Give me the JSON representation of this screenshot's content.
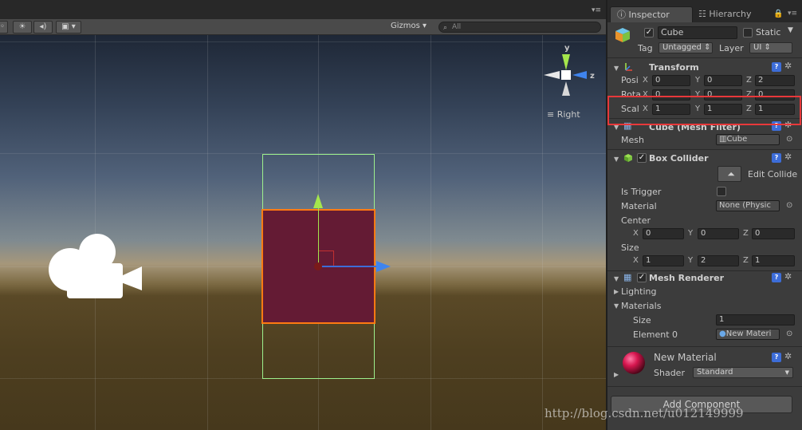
{
  "scene": {
    "gizmos_label": "Gizmos",
    "search_placeholder": "All",
    "orientation_label": "Right",
    "axis_y": "y",
    "axis_z": "z"
  },
  "tabs": {
    "inspector": "Inspector",
    "hierarchy": "Hierarchy"
  },
  "object": {
    "name": "Cube",
    "static_label": "Static",
    "tag_label": "Tag",
    "tag_value": "Untagged",
    "layer_label": "Layer",
    "layer_value": "UI"
  },
  "transform": {
    "title": "Transform",
    "position_label": "Posi",
    "rotation_label": "Rota",
    "scale_label": "Scal",
    "position": {
      "x": "0",
      "y": "0",
      "z": "2"
    },
    "rotation": {
      "x": "0",
      "y": "0",
      "z": "0"
    },
    "scale": {
      "x": "1",
      "y": "1",
      "z": "1"
    }
  },
  "mesh_filter": {
    "title": "Cube (Mesh Filter)",
    "mesh_label": "Mesh",
    "mesh_value": "Cube"
  },
  "box_collider": {
    "title": "Box Collider",
    "edit_label": "Edit Collide",
    "is_trigger_label": "Is Trigger",
    "material_label": "Material",
    "material_value": "None (Physic",
    "center_label": "Center",
    "center": {
      "x": "0",
      "y": "0",
      "z": "0"
    },
    "size_label": "Size",
    "size": {
      "x": "1",
      "y": "2",
      "z": "1"
    }
  },
  "mesh_renderer": {
    "title": "Mesh Renderer",
    "lighting_label": "Lighting",
    "materials_label": "Materials",
    "size_label": "Size",
    "size_value": "1",
    "element_label": "Element 0",
    "element_value": "New Materi"
  },
  "material": {
    "name": "New Material",
    "shader_label": "Shader",
    "shader_value": "Standard"
  },
  "add_component_label": "Add Component",
  "watermark": "http://blog.csdn.net/u012149999",
  "axis_letters": {
    "x": "X",
    "y": "Y",
    "z": "Z"
  },
  "colors": {
    "highlight": "#e8383a",
    "selection_outline": "#ff7a12",
    "cube_fill": "#641b34",
    "bounds": "#9df08d",
    "axis_y": "#a5e64c",
    "axis_z": "#3f84ee"
  }
}
